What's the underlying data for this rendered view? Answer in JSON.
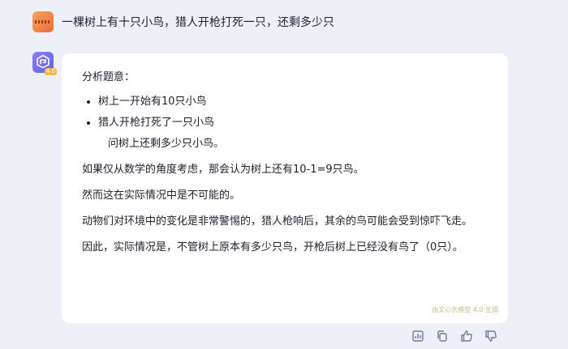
{
  "user_message": "一棵树上有十只小鸟，猎人开枪打死一只，还剩多少只",
  "bot": {
    "version_badge": "4.0",
    "intro": "分析题意：",
    "bullets": [
      "树上一开始有10只小鸟",
      "猎人开枪打死了一只小鸟"
    ],
    "question": "问树上还剩多少只小鸟。",
    "paragraphs": [
      "如果仅从数学的角度考虑，那会认为树上还有10-1=9只鸟。",
      "然而这在实际情况中是不可能的。",
      "动物们对环境中的变化是非常警惕的，猎人枪响后，其余的鸟可能会受到惊吓飞走。",
      "因此，实际情况是，不管树上原本有多少只鸟，开枪后树上已经没有鸟了（0只）。"
    ],
    "watermark": "由文心大模型 4.0 生成"
  },
  "actions": {
    "icons": [
      "chart-icon",
      "copy-icon",
      "thumbs-up-icon",
      "thumbs-down-icon"
    ]
  }
}
